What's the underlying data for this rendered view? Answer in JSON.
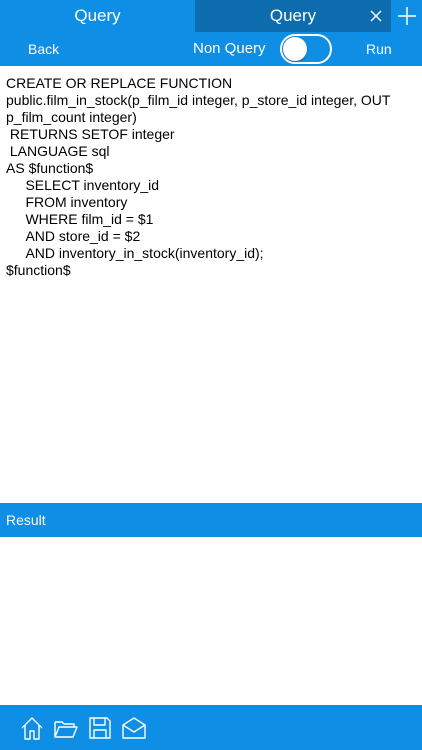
{
  "tabs": [
    {
      "label": "Query"
    },
    {
      "label": "Query"
    }
  ],
  "toolbar": {
    "back_label": "Back",
    "mode_label": "Non Query",
    "run_label": "Run"
  },
  "editor": {
    "text": "CREATE OR REPLACE FUNCTION\npublic.film_in_stock(p_film_id integer, p_store_id integer, OUT p_film_count integer)\n RETURNS SETOF integer\n LANGUAGE sql\nAS $function$\n     SELECT inventory_id\n     FROM inventory\n     WHERE film_id = $1\n     AND store_id = $2\n     AND inventory_in_stock(inventory_id);\n$function$"
  },
  "result": {
    "title": "Result"
  },
  "icons": {
    "close": "close-icon",
    "add": "plus-icon",
    "home": "home-icon",
    "folder": "folder-open-icon",
    "save": "save-icon",
    "mail": "mail-open-icon"
  },
  "colors": {
    "accent": "#0f8ee5",
    "active_tab": "#0c6cae"
  }
}
